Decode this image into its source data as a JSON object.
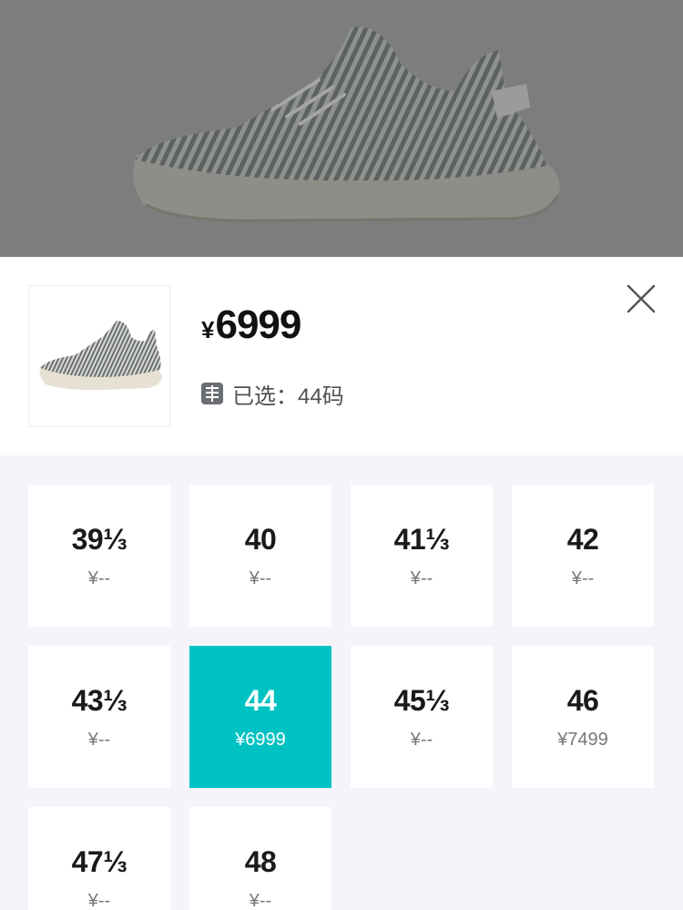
{
  "product": {
    "currency": "¥",
    "price": "6999",
    "selected_label": "已选：44码"
  },
  "sizes": [
    {
      "size": "39⅓",
      "price": "¥--",
      "selected": false
    },
    {
      "size": "40",
      "price": "¥--",
      "selected": false
    },
    {
      "size": "41⅓",
      "price": "¥--",
      "selected": false
    },
    {
      "size": "42",
      "price": "¥--",
      "selected": false
    },
    {
      "size": "43⅓",
      "price": "¥--",
      "selected": false
    },
    {
      "size": "44",
      "price": "¥6999",
      "selected": true
    },
    {
      "size": "45⅓",
      "price": "¥--",
      "selected": false
    },
    {
      "size": "46",
      "price": "¥7499",
      "selected": false
    },
    {
      "size": "47⅓",
      "price": "¥--",
      "selected": false
    },
    {
      "size": "48",
      "price": "¥--",
      "selected": false
    }
  ],
  "colors": {
    "accent": "#01c2c3",
    "overlay": "#7b7e7c"
  },
  "icons": {
    "close": "close-icon",
    "selected": "selected-info-icon"
  }
}
